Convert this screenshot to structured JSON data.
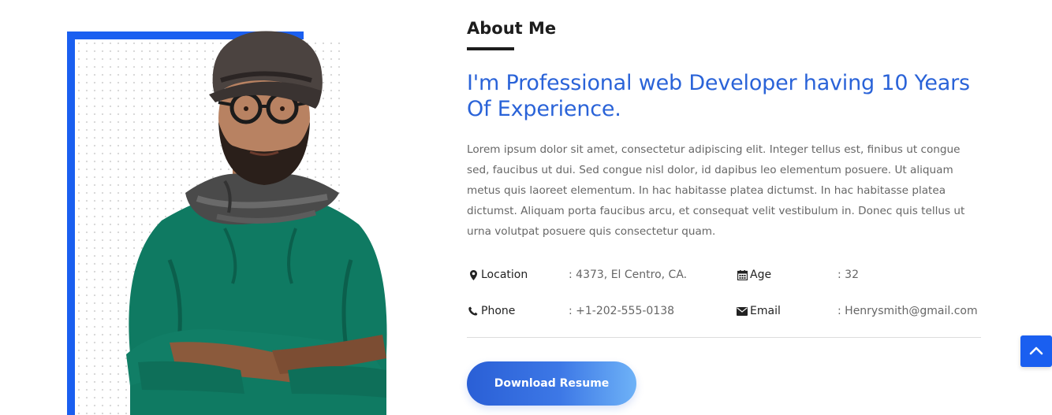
{
  "about": {
    "section_title": "About Me",
    "headline": "I'm Professional web Developer having 10 Years Of Experience.",
    "bio": "Lorem ipsum dolor sit amet, consectetur adipiscing elit. Integer tellus est, finibus ut congue sed, faucibus ut dui. Sed congue nisl dolor, id dapibus leo elementum posuere. Ut aliquam metus quis laoreet elementum. In hac habitasse platea dictumst. In hac habitasse platea dictumst. Aliquam porta faucibus arcu, et consequat velit vestibulum in. Donec quis tellus ut urna volutpat posuere quis consectetur quam."
  },
  "info": {
    "location": {
      "label": "Location",
      "value": ": 4373, El Centro, CA.",
      "icon": "map-marker-icon"
    },
    "age": {
      "label": "Age",
      "value": ": 32",
      "icon": "calendar-icon"
    },
    "phone": {
      "label": "Phone",
      "value": ": +1-202-555-0138",
      "icon": "phone-icon"
    },
    "email": {
      "label": "Email",
      "value": ": Henrysmith@gmail.com",
      "icon": "envelope-icon"
    }
  },
  "actions": {
    "download_label": "Download Resume",
    "back_to_top_icon": "chevron-up-icon"
  },
  "colors": {
    "accent": "#1a5ff0",
    "headline": "#2a63d8",
    "text": "#666666",
    "sweater": "#0f7a62",
    "scarf": "#4a4a4a"
  }
}
